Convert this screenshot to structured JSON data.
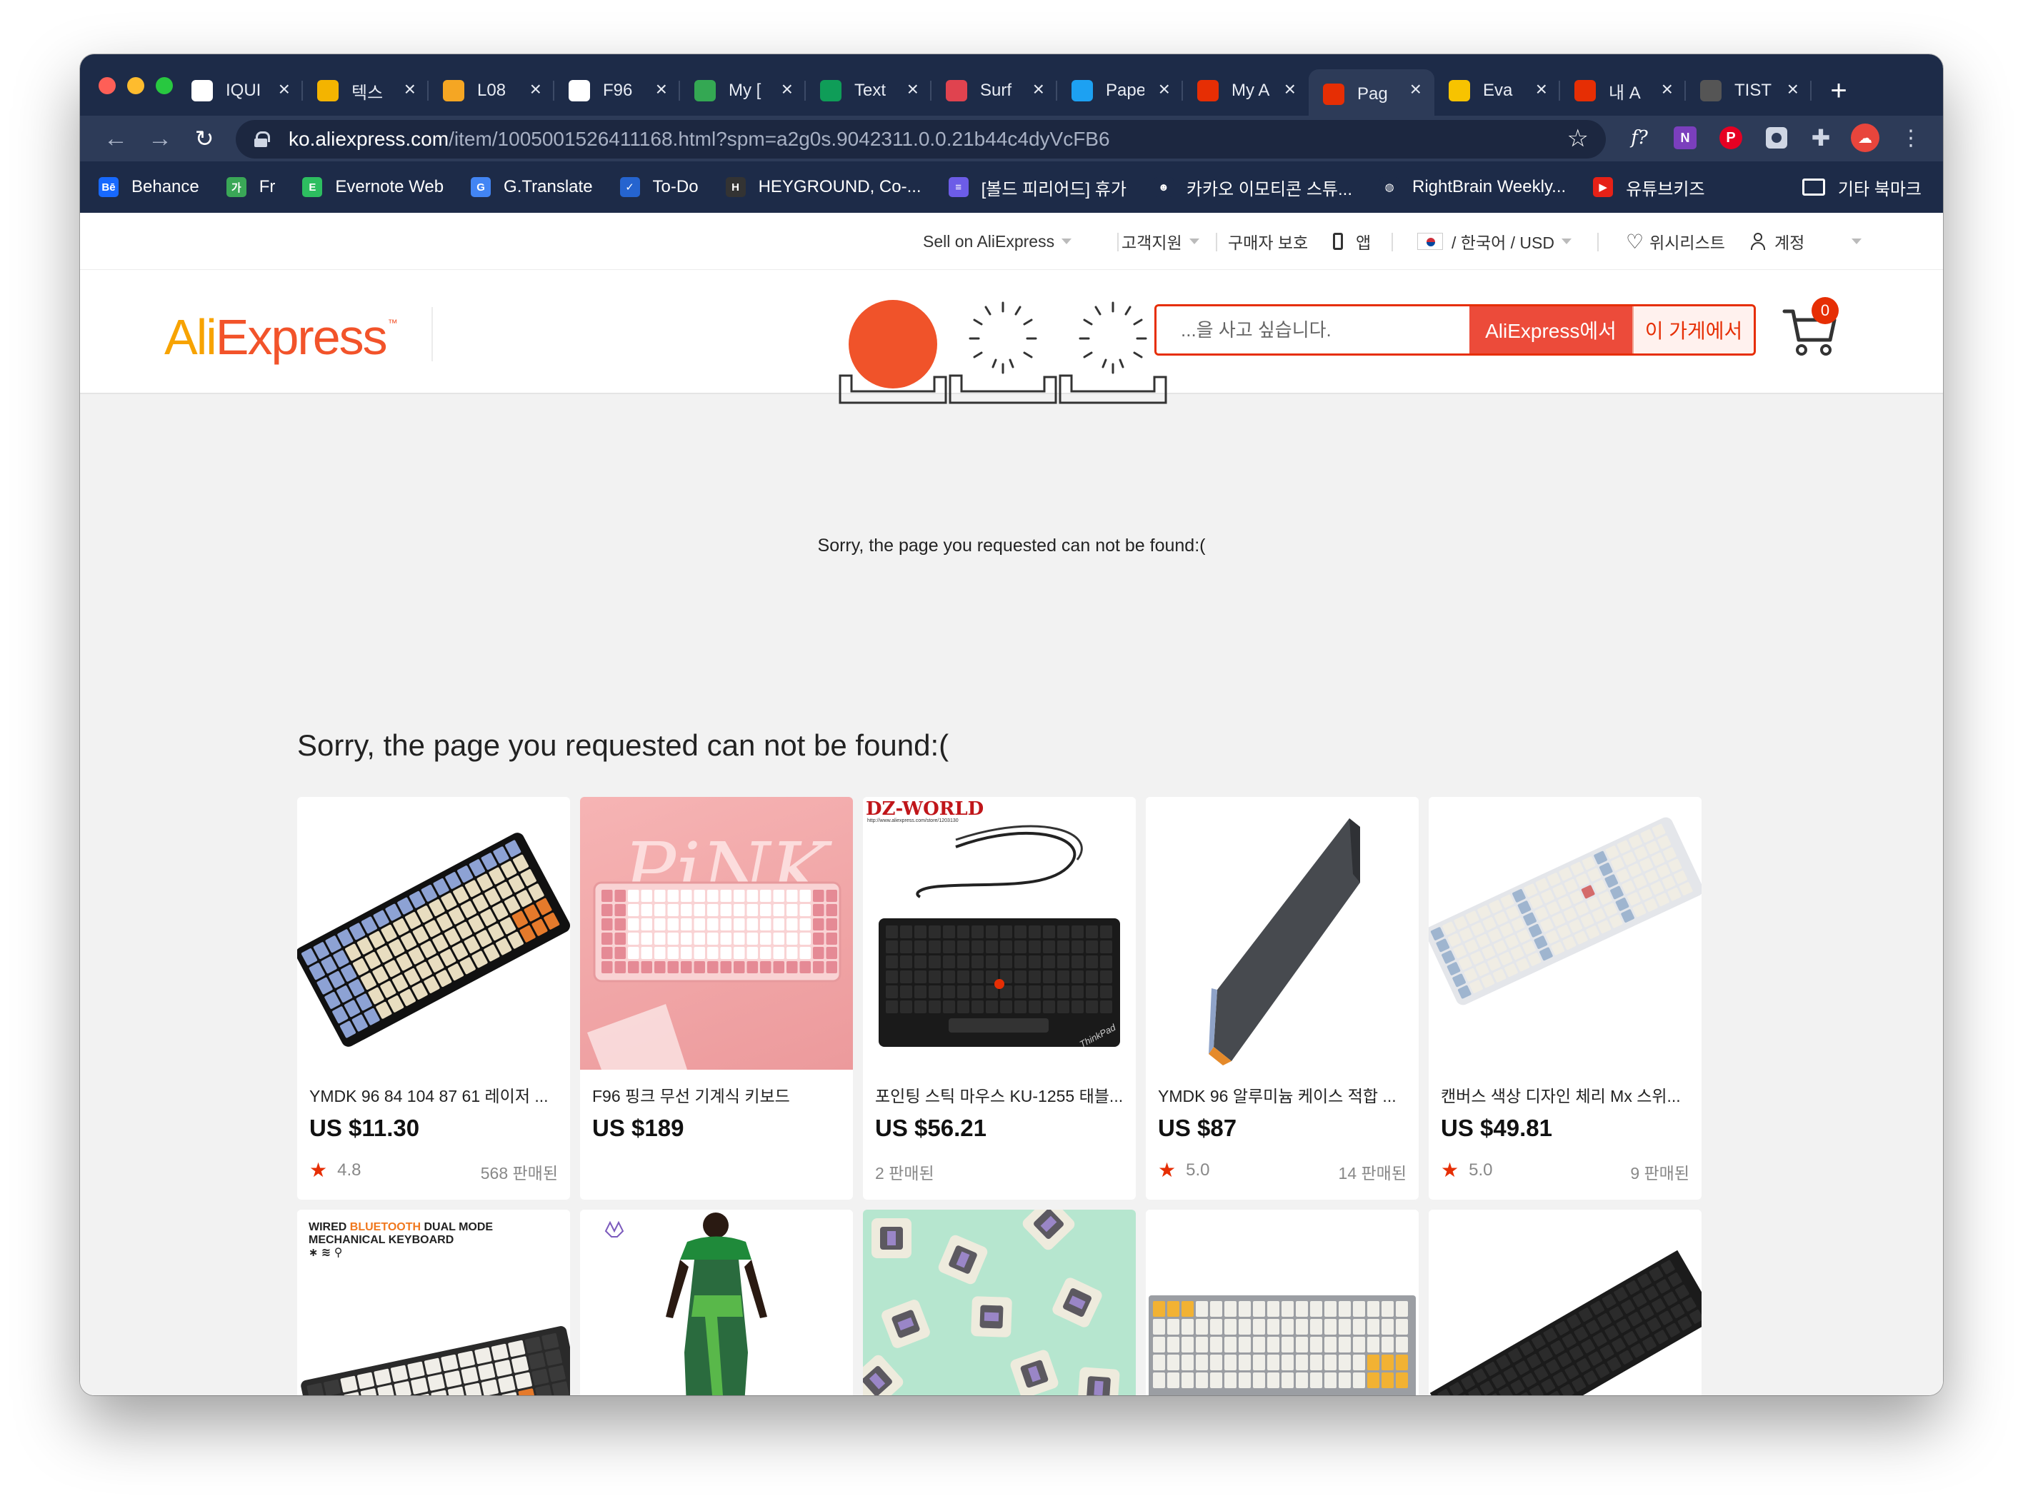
{
  "browser": {
    "tabs": [
      {
        "label": "IQUI",
        "icon": "google-icon",
        "color": "#ffffff"
      },
      {
        "label": "텍스",
        "icon": "slides-icon",
        "color": "#f4b400"
      },
      {
        "label": "L08",
        "icon": "bread-icon",
        "color": "#f5a623"
      },
      {
        "label": "F96",
        "icon": "info-icon",
        "color": "#ffffff"
      },
      {
        "label": "My [",
        "icon": "drive-icon",
        "color": "#34a853"
      },
      {
        "label": "Text",
        "icon": "sheets-icon",
        "color": "#0f9d58"
      },
      {
        "label": "Surf",
        "icon": "surfshark-icon",
        "color": "#e0434f"
      },
      {
        "label": "Pape",
        "icon": "paper-icon",
        "color": "#1da1f2"
      },
      {
        "label": "My A",
        "icon": "aliexpress-icon",
        "color": "#e62e04"
      },
      {
        "label": "Pag",
        "icon": "cart-icon",
        "color": "#e62e04"
      },
      {
        "label": "Eva",
        "icon": "owl-icon",
        "color": "#f7c300"
      },
      {
        "label": "내 A",
        "icon": "aliexpress-icon",
        "color": "#e62e04"
      },
      {
        "label": "TIST",
        "icon": "tistory-icon",
        "color": "#555555"
      }
    ],
    "active_tab": 9,
    "url_host": "ko.aliexpress.com",
    "url_path": "/item/1005001526411168.html?spm=a2g0s.9042311.0.0.21b44c4dyVcFB6",
    "bookmarks": [
      {
        "label": "Behance",
        "icon": "behance-icon",
        "color": "#1769ff",
        "glyph": "Bē"
      },
      {
        "label": "Fr",
        "icon": "fr-icon",
        "color": "#3aa757",
        "glyph": "가"
      },
      {
        "label": "Evernote Web",
        "icon": "evernote-icon",
        "color": "#2dbe60",
        "glyph": "E"
      },
      {
        "label": "G.Translate",
        "icon": "translate-icon",
        "color": "#4285f4",
        "glyph": "G"
      },
      {
        "label": "To-Do",
        "icon": "todo-icon",
        "color": "#2564cf",
        "glyph": "✓"
      },
      {
        "label": "HEYGROUND, Co-...",
        "icon": "heyground-icon",
        "color": "#333333",
        "glyph": "H"
      },
      {
        "label": "[볼드 피리어드] 휴가",
        "icon": "list-icon",
        "color": "#6c5ce7",
        "glyph": "≡"
      },
      {
        "label": "카카오 이모티콘 스튜...",
        "icon": "kakao-icon",
        "color": "#1d2b48",
        "glyph": "☻"
      },
      {
        "label": "RightBrain Weekly...",
        "icon": "globe-icon",
        "color": "#1d2b48",
        "glyph": "◍"
      },
      {
        "label": "유튜브키즈",
        "icon": "youtube-kids-icon",
        "color": "#e62117",
        "glyph": "▶"
      }
    ],
    "other_bookmarks": "기타 북마크"
  },
  "topbar": {
    "sell": "Sell on AliExpress",
    "support": "고객지원",
    "protection": "구매자 보호",
    "app": "앱",
    "locale": "/ 한국어 /  USD",
    "wishlist": "위시리스트",
    "account": "계정"
  },
  "header": {
    "logo_ali": "Ali",
    "logo_express": "Express",
    "logo_tm": "™",
    "search_placeholder": "...을 사고 싶습니다.",
    "search_all": "AliExpress에서",
    "search_store": "이 가게에서",
    "cart_count": "0"
  },
  "main": {
    "error_message": "Sorry, the page you requested can not be found:(",
    "heading": "Sorry, the page you requested can not be found:("
  },
  "products": [
    {
      "title": "YMDK 96 84 104 87 61 레이저 ...",
      "price": "US $11.30",
      "rating": "4.8",
      "sold": "568 판매된"
    },
    {
      "title": "F96 핑크 무선 기계식 키보드",
      "price": "US $189",
      "rating": "",
      "sold": ""
    },
    {
      "title": "포인팅 스틱 마우스 KU-1255 태블...",
      "price": "US $56.21",
      "rating": "",
      "sold": "2 판매된"
    },
    {
      "title": "YMDK 96 알루미늄 케이스 적합 ...",
      "price": "US $87",
      "rating": "5.0",
      "sold": "14 판매된"
    },
    {
      "title": "캔버스 색상 디자인 체리 Mx 스위...",
      "price": "US $49.81",
      "rating": "5.0",
      "sold": "9 판매된"
    }
  ],
  "product_images": {
    "pink_text": "PiNK",
    "dz_brand": "DZ-WORLD",
    "dz_sub": "http://www.aliexpress.com/store/1203130",
    "thinkpad": "ThinkPad",
    "wired_line1_a": "WIRED ",
    "wired_line1_b": "BLUETOOTH",
    "wired_line1_c": " DUAL MODE",
    "wired_line2": "MECHANICAL KEYBOARD"
  }
}
